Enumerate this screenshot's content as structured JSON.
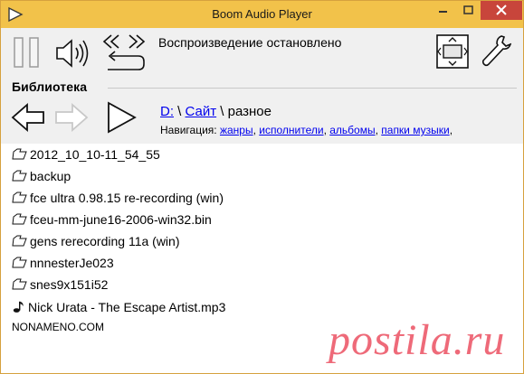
{
  "window": {
    "title": "Boom Audio Player",
    "colors": {
      "titlebar": "#f2c24a",
      "close": "#c8453b",
      "link": "#0000ee",
      "watermark": "#ee6372"
    }
  },
  "toolbar": {
    "status": "Воспроизведение остановлено",
    "icons": [
      "pause-icon",
      "volume-icon",
      "shuffle-repeat-icon",
      "resize-window-icon",
      "settings-wrench-icon"
    ]
  },
  "library": {
    "label": "Библиотека",
    "nav_icons": [
      "back-arrow-icon",
      "forward-arrow-icon",
      "play-icon"
    ],
    "breadcrumb": {
      "drive": "D:",
      "sep1": " \\ ",
      "site": "Сайт",
      "sep2": " \\ ",
      "current": "разное"
    },
    "navigation": {
      "prefix": "Навигация: ",
      "links": [
        "жанры",
        "исполнители",
        "альбомы",
        "папки музыки"
      ],
      "sep": ", ",
      "trail": ","
    }
  },
  "files": [
    {
      "type": "folder",
      "name": "2012_10_10-11_54_55"
    },
    {
      "type": "folder",
      "name": "backup"
    },
    {
      "type": "folder",
      "name": "fce ultra 0.98.15 re-recording (win)"
    },
    {
      "type": "folder",
      "name": "fceu-mm-june16-2006-win32.bin"
    },
    {
      "type": "folder",
      "name": "gens rerecording 11a (win)"
    },
    {
      "type": "folder",
      "name": "nnnesterJe023"
    },
    {
      "type": "folder",
      "name": "snes9x151i52"
    },
    {
      "type": "audio",
      "name": "Nick Urata - The Escape Artist.mp3"
    }
  ],
  "footer": "NONAMENO.COM",
  "watermark": "postila.ru"
}
